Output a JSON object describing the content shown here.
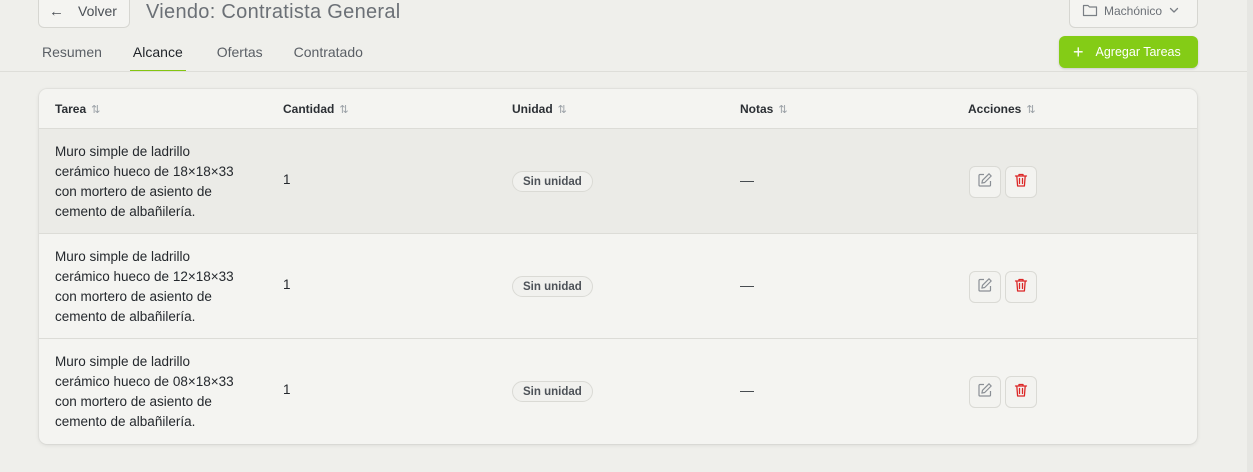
{
  "header": {
    "back_label": "Volver",
    "title": "Viendo: Contratista General",
    "project_select": {
      "value": "Machónico"
    }
  },
  "tabs": [
    {
      "label": "Resumen",
      "active": false
    },
    {
      "label": "Alcance",
      "active": true
    },
    {
      "label": "Ofertas",
      "active": false
    },
    {
      "label": "Contratado",
      "active": false
    }
  ],
  "toolbar": {
    "add_label": "Agregar Tareas"
  },
  "table": {
    "columns": [
      {
        "label": "Tarea"
      },
      {
        "label": "Cantidad"
      },
      {
        "label": "Unidad"
      },
      {
        "label": "Notas"
      },
      {
        "label": "Acciones"
      }
    ],
    "rows": [
      {
        "task_lines": [
          "Muro simple de ladrillo",
          "cerámico hueco de 18×18×33",
          "con mortero de asiento de",
          "cemento de albañilería."
        ],
        "quantity": "1",
        "unit": "Sin unidad",
        "notes": "—"
      },
      {
        "task_lines": [
          "Muro simple de ladrillo",
          "cerámico hueco de 12×18×33",
          "con mortero de asiento de",
          "cemento de albañilería."
        ],
        "quantity": "1",
        "unit": "Sin unidad",
        "notes": "—"
      },
      {
        "task_lines": [
          "Muro simple de ladrillo",
          "cerámico hueco de 08×18×33",
          "con mortero de asiento de",
          "cemento de albañilería."
        ],
        "quantity": "1",
        "unit": "Sin unidad",
        "notes": "—"
      }
    ]
  },
  "colors": {
    "accent": "#84cc16",
    "delete": "#dc2626",
    "background": "#efefeb",
    "card": "#f4f4f1"
  },
  "icons": {
    "back": "arrow-left-icon",
    "folder": "folder-icon",
    "chevron": "chevron-down-icon",
    "add": "plus-icon",
    "sort": "sort-arrows-icon",
    "edit": "edit-icon",
    "delete": "trash-icon"
  }
}
